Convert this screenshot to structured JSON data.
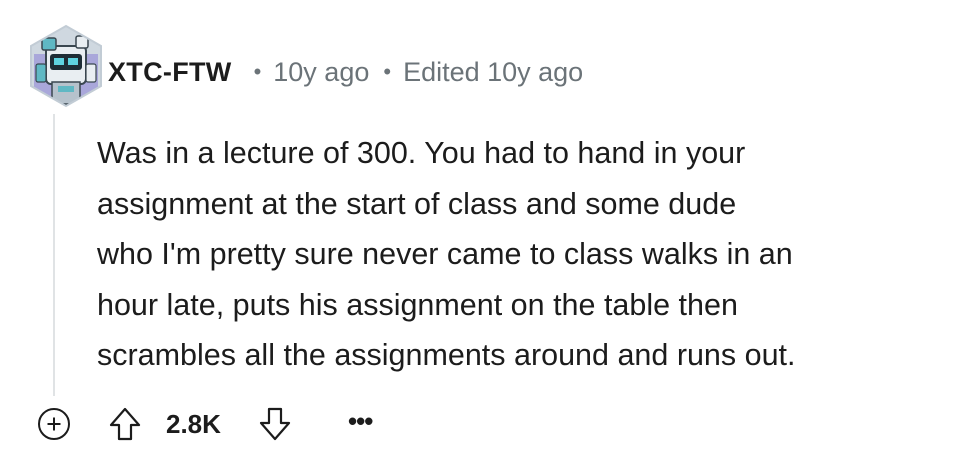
{
  "comment": {
    "author": "XTC-FTW",
    "separator": "•",
    "time": "10y ago",
    "edited": "Edited 10y ago",
    "body_lines": [
      "Was in a lecture of 300. You had to hand in your",
      "assignment at the start of class and some dude",
      "who I'm pretty sure never came to class walks in an",
      "hour late, puts his assignment on the table then",
      "scrambles all the assignments around and runs out."
    ],
    "score": "2.8K",
    "more_label": "•••"
  },
  "icons": {
    "avatar": "robot-avatar-icon",
    "expand": "plus-circle-icon",
    "upvote": "arrow-up-icon",
    "downvote": "arrow-down-icon",
    "more": "ellipsis-icon"
  },
  "colors": {
    "text": "#1c1c1c",
    "meta": "#6b7378",
    "thread_line": "#e0e3e5",
    "avatar_teal": "#5fb8c4",
    "avatar_hex": "#c9d3dc"
  }
}
